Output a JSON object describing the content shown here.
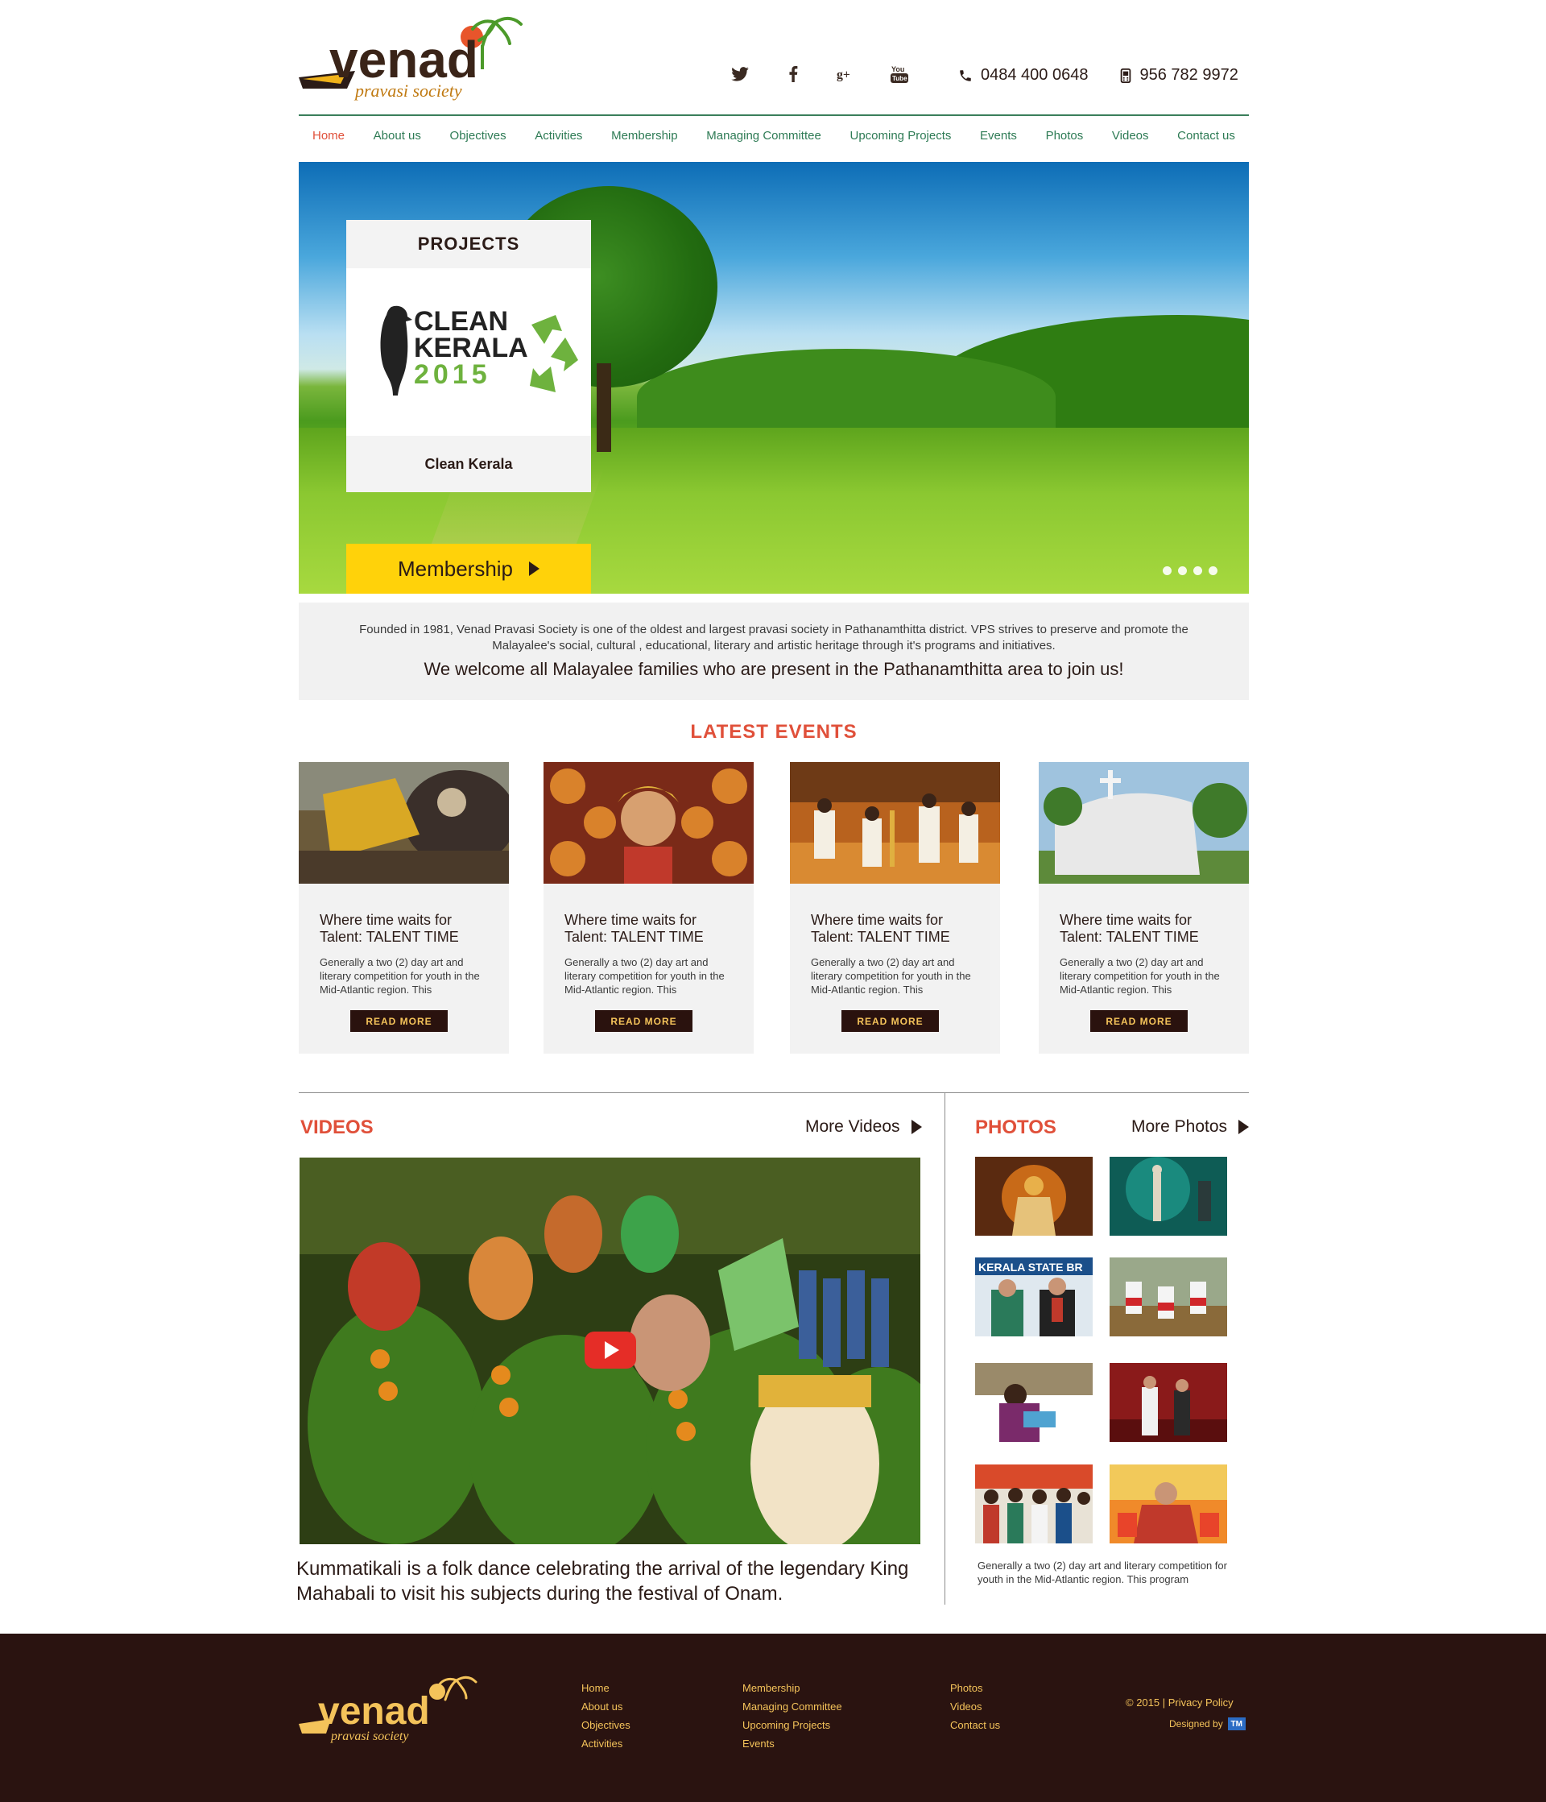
{
  "header": {
    "logo_main": "venad",
    "logo_sub": "pravasi society",
    "social": [
      {
        "name": "twitter-icon",
        "glyph": "🐦"
      },
      {
        "name": "facebook-icon",
        "glyph": "f"
      },
      {
        "name": "google-plus-icon",
        "glyph": "g+"
      },
      {
        "name": "youtube-icon",
        "glyph": "You Tube"
      }
    ],
    "phone_landline": "0484 400 0648",
    "phone_mobile": "956 782 9972"
  },
  "nav": {
    "items": [
      "Home",
      "About us",
      "Objectives",
      "Activities",
      "Membership",
      "Managing Committee",
      "Upcoming Projects",
      "Events",
      "Photos",
      "Videos",
      "Contact us"
    ],
    "active": "Home"
  },
  "hero": {
    "card_title": "PROJECTS",
    "card_logo_line1": "CLEAN",
    "card_logo_line2": "KERALA",
    "card_logo_year": "2015",
    "card_name": "Clean Kerala",
    "membership_button": "Membership",
    "slides": 4
  },
  "intro": {
    "body": "Founded in 1981, Venad Pravasi Society is one of the oldest and largest pravasi society in Pathanamthitta district. VPS strives to preserve and promote the Malayalee's social, cultural , educational, literary and artistic heritage through it's programs and initiatives.",
    "call": "We welcome all Malayalee families who are present in the Pathanamthitta area to join us!"
  },
  "events": {
    "title": "LATEST EVENTS",
    "items": [
      {
        "title": "Where time waits for Talent: TALENT TIME",
        "desc": "Generally a two (2) day art and literary competition for youth in the Mid-Atlantic region. This",
        "button": "READ MORE"
      },
      {
        "title": "Where time waits for Talent: TALENT TIME",
        "desc": "Generally a two (2) day art and literary competition for youth in the Mid-Atlantic region. This",
        "button": "READ MORE"
      },
      {
        "title": "Where time waits for Talent: TALENT TIME",
        "desc": "Generally a two (2) day art and literary competition for youth in the Mid-Atlantic region. This",
        "button": "READ MORE"
      },
      {
        "title": "Where time waits for Talent: TALENT TIME",
        "desc": "Generally a two (2) day art and literary competition for youth in the Mid-Atlantic region. This",
        "button": "READ MORE"
      }
    ]
  },
  "videos": {
    "title": "VIDEOS",
    "more": "More Videos",
    "caption": "Kummatikali is a folk dance celebrating the arrival of the legendary King Mahabali to visit his subjects during the festival of Onam."
  },
  "photos": {
    "title": "PHOTOS",
    "more": "More Photos",
    "caption": "Generally a two (2) day art and literary competition for youth in the Mid-Atlantic region. This program",
    "banner_text": "KERALA STATE BR"
  },
  "footer": {
    "col1": [
      "Home",
      "About us",
      "Objectives",
      "Activities"
    ],
    "col2": [
      "Membership",
      "Managing Committee",
      "Upcoming Projects",
      "Events"
    ],
    "col3": [
      "Photos",
      "Videos",
      "Contact us"
    ],
    "copyright": "© 2015",
    "privacy": "Privacy Policy",
    "designed_by": "Designed by",
    "designer_badge": "TM"
  },
  "colors": {
    "accent_red": "#e0503a",
    "nav_green": "#2e7b55",
    "membership_yellow": "#ffd20a",
    "dark_brown": "#2a1310",
    "footer_gold": "#f4c35a"
  }
}
